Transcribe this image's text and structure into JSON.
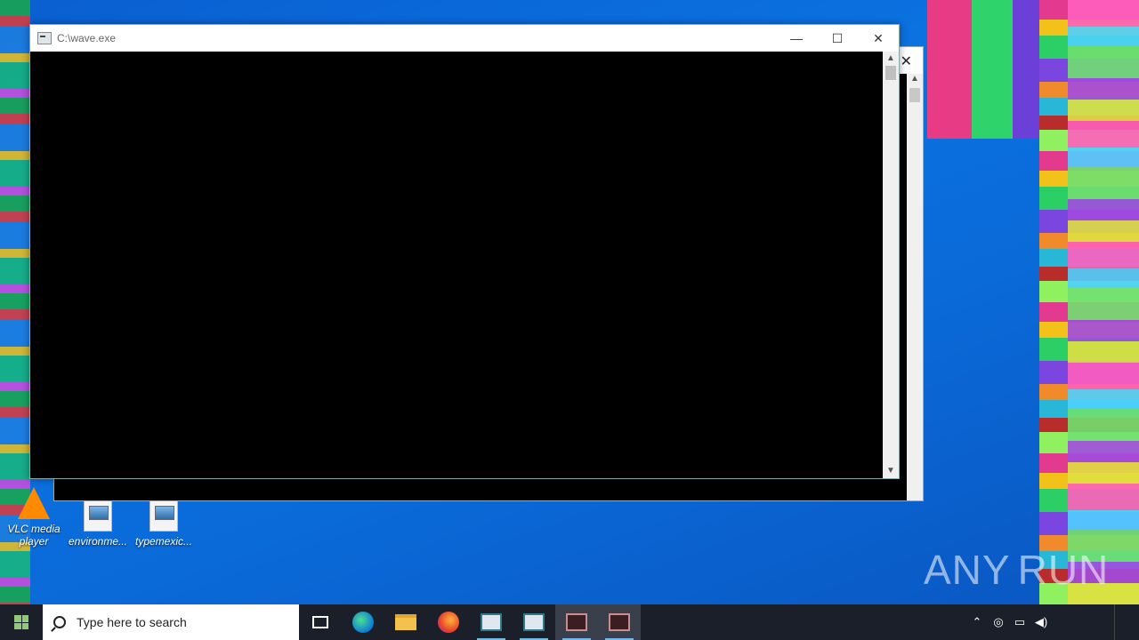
{
  "desktop": {
    "icons": [
      {
        "label": "VLC media player",
        "glyph": "vlc-icon"
      },
      {
        "label": "environme...",
        "glyph": "image-file-icon"
      },
      {
        "label": "typemexic...",
        "glyph": "image-file-icon"
      }
    ],
    "watermark": {
      "left": "ANY",
      "right": "RUN"
    }
  },
  "console_window": {
    "title": "C:\\wave.exe",
    "minimize": "—",
    "maximize": "☐",
    "close": "✕"
  },
  "back_window": {
    "close": "✕"
  },
  "taskbar": {
    "search_placeholder": "Type here to search",
    "apps": [
      "task-view",
      "edge",
      "file-explorer",
      "firefox",
      "console-app",
      "console-app",
      "film-app",
      "film-app"
    ],
    "tray_up": "⌃",
    "tray_clock_time": "",
    "tray_clock_date": ""
  },
  "colors": {
    "desktop_blue": "#0a6ad8",
    "taskbar": "#1b1f2a",
    "console_bg": "#000000"
  }
}
